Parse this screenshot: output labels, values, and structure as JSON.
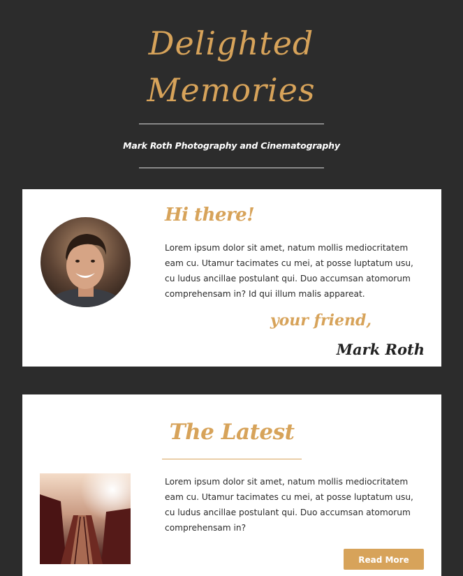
{
  "header": {
    "logo_line1": "Delighted",
    "logo_line2": "Memories",
    "tagline": "Mark Roth Photography and Cinematography"
  },
  "intro": {
    "heading": "Hi there!",
    "body": "Lorem ipsum dolor sit amet, natum mollis mediocritatem eam cu. Utamur tacimates cu mei, at posse luptatum usu, cu ludus ancillae postulant qui. Duo accumsan atomorum comprehensam in? Id qui illum malis appareat.",
    "closing": "your friend,",
    "signature": "Mark Roth"
  },
  "latest": {
    "heading": "The Latest",
    "body": "Lorem ipsum dolor sit amet, natum mollis mediocritatem eam cu. Utamur tacimates cu mei, at posse luptatum usu, cu ludus ancillae postulant qui. Duo accumsan atomorum comprehensam in?",
    "button_label": "Read More"
  },
  "colors": {
    "background": "#2c2c2c",
    "accent": "#d7a35a",
    "card": "#ffffff"
  }
}
